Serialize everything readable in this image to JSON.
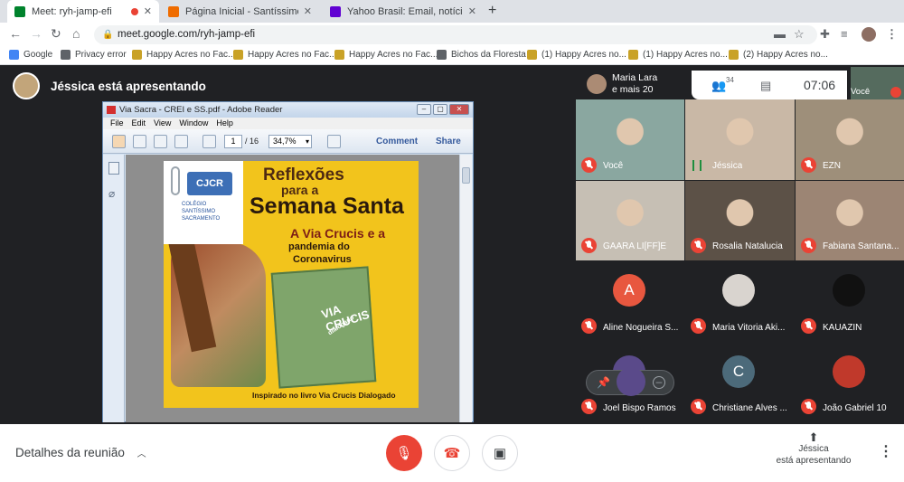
{
  "browser": {
    "tabs": [
      {
        "title": "Meet: ryh-jamp-efi",
        "fav_color": "#00832d"
      },
      {
        "title": "Página Inicial - Santíssimo Sacram",
        "fav_color": "#ef6c00"
      },
      {
        "title": "Yahoo Brasil: Email, notícias, fina",
        "fav_color": "#6001d2"
      }
    ],
    "url": "meet.google.com/ryh-jamp-efi",
    "bookmarks": [
      {
        "label": "Google",
        "color": "#4285f4"
      },
      {
        "label": "Privacy error",
        "color": "#5f6368"
      },
      {
        "label": "Happy Acres no Fac...",
        "color": "#c9a227"
      },
      {
        "label": "Happy Acres no Fac...",
        "color": "#c9a227"
      },
      {
        "label": "Happy Acres no Fac...",
        "color": "#c9a227"
      },
      {
        "label": "Bichos da Floresta",
        "color": "#5f6368"
      },
      {
        "label": "(1) Happy Acres no...",
        "color": "#c9a227"
      },
      {
        "label": "(1) Happy Acres no...",
        "color": "#c9a227"
      },
      {
        "label": "(2) Happy Acres no...",
        "color": "#c9a227"
      }
    ]
  },
  "meet": {
    "presenter_banner": "Jéssica está apresentando",
    "host_name": "Maria Lara",
    "host_more": "e mais 20",
    "people_count": "34",
    "time": "07:06",
    "self_label": "Você",
    "details_label": "Detalhes da reunião",
    "presenting_line1": "Jéssica",
    "presenting_line2": "está apresentando"
  },
  "reader": {
    "window_title": "Via Sacra - CREI e SS.pdf - Adobe Reader",
    "menu": [
      "File",
      "Edit",
      "View",
      "Window",
      "Help"
    ],
    "page_current": "1",
    "page_total": "/ 16",
    "zoom": "34,7%",
    "comment_label": "Comment",
    "share_label": "Share"
  },
  "cover": {
    "logo": "CJCR",
    "school": "COLÉGIO SANTÍSSIMO SACRAMENTO",
    "title_line1": "Reflexões",
    "title_line2": "para a",
    "title_line3": "Semana Santa",
    "subtitle_line1": "A Via Crucis e a",
    "subtitle_line2": "pandemia do",
    "subtitle_line3": "Coronavirus",
    "book_title": "VIA CRUCIS",
    "book_sub": "dialogado",
    "footer": "Inspirado no livro Via Crucis Dialogado"
  },
  "participants": [
    {
      "name": "Você",
      "kind": "video",
      "bg": "#8aa7a0"
    },
    {
      "name": "Jéssica",
      "kind": "video",
      "bg": "#c9b8a6",
      "speaking": true
    },
    {
      "name": "EZN",
      "kind": "video",
      "bg": "#9e8f7a"
    },
    {
      "name": "GAARA LI[FF]E",
      "kind": "video",
      "bg": "#c6bfb4"
    },
    {
      "name": "Rosalia Natalucia",
      "kind": "video",
      "bg": "#5c5147"
    },
    {
      "name": "Fabiana Santana...",
      "kind": "video",
      "bg": "#9c8574"
    },
    {
      "name": "Aline Nogueira S...",
      "kind": "avatar",
      "initial": "A",
      "av_color": "#e8573f"
    },
    {
      "name": "Maria Vitoria Aki...",
      "kind": "avatar",
      "initial": "",
      "av_color": "#d9d4cf"
    },
    {
      "name": "KAUAZIN",
      "kind": "avatar",
      "initial": "",
      "av_color": "#111111"
    },
    {
      "name": "Joel Bispo Ramos",
      "kind": "avatar",
      "initial": "",
      "av_color": "#5a4a8a"
    },
    {
      "name": "Christiane Alves ...",
      "kind": "avatar",
      "initial": "C",
      "av_color": "#4c6a7a"
    },
    {
      "name": "João Gabriel 10",
      "kind": "avatar",
      "initial": "",
      "av_color": "#c0392b"
    }
  ]
}
